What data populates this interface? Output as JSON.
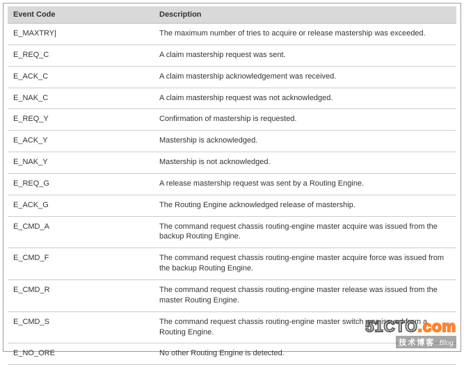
{
  "table": {
    "headers": {
      "code": "Event Code",
      "desc": "Description"
    },
    "rows": [
      {
        "code": "E_MAXTRY|",
        "desc": "The maximum number of tries to acquire or release mastership was exceeded."
      },
      {
        "code": "E_REQ_C",
        "desc": "A claim mastership request was sent."
      },
      {
        "code": "E_ACK_C",
        "desc": "A claim mastership acknowledgement was received."
      },
      {
        "code": "E_NAK_C",
        "desc": "A claim mastership request was not acknowledged."
      },
      {
        "code": "E_REQ_Y",
        "desc": "Confirmation of mastership is requested."
      },
      {
        "code": "E_ACK_Y",
        "desc": "Mastership is acknowledged."
      },
      {
        "code": "E_NAK_Y",
        "desc": "Mastership is not acknowledged."
      },
      {
        "code": "E_REQ_G",
        "desc": "A release mastership request was sent by a Routing Engine."
      },
      {
        "code": "E_ACK_G",
        "desc": "The Routing Engine acknowledged release of mastership."
      },
      {
        "code": "E_CMD_A",
        "desc": "The command request chassis routing-engine master acquire was issued from the backup Routing Engine."
      },
      {
        "code": "E_CMD_F",
        "desc": "The command request chassis routing-engine master acquire force was issued from the backup Routing Engine."
      },
      {
        "code": "E_CMD_R",
        "desc": "The command request chassis routing-engine master release was issued from the master Routing Engine."
      },
      {
        "code": "E_CMD_S",
        "desc": "The command request chassis routing-engine master switch was issued from a Routing Engine."
      },
      {
        "code": "E_NO_ORE",
        "desc": "No other Routing Engine is detected."
      }
    ]
  },
  "watermark": {
    "main_a": "51CTO",
    "main_b": ".com",
    "sub_a": "技术博客",
    "sub_b": "Blog"
  }
}
